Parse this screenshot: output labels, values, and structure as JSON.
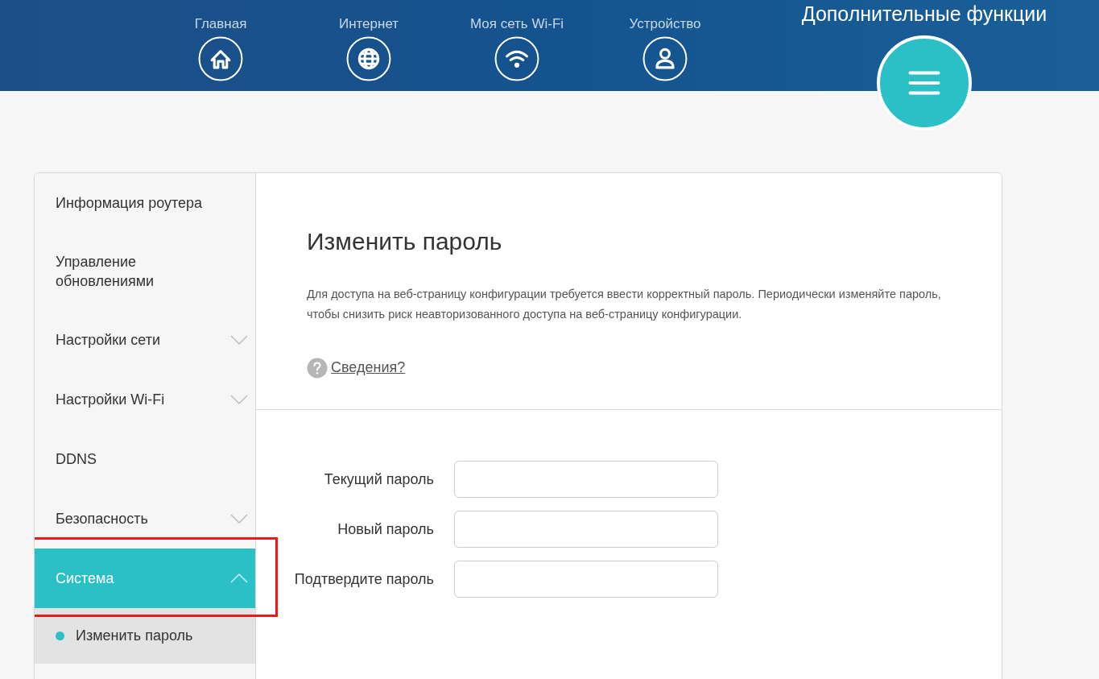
{
  "nav": [
    {
      "label": "Главная",
      "kind": "home",
      "selected": false
    },
    {
      "label": "Интернет",
      "kind": "globe",
      "selected": false
    },
    {
      "label": "Моя сеть Wi-Fi",
      "kind": "wifi",
      "selected": false
    },
    {
      "label": "Устройство",
      "kind": "user",
      "selected": false
    },
    {
      "label": "Дополнительные функции",
      "kind": "menu",
      "selected": true
    }
  ],
  "sidebar": {
    "items": [
      {
        "label": "Информация роутера",
        "expandable": false,
        "selected": false,
        "highlighted": false
      },
      {
        "label": "Управление обновлениями",
        "expandable": false,
        "selected": false,
        "highlighted": false
      },
      {
        "label": "Настройки сети",
        "expandable": true,
        "expanded": false,
        "selected": false,
        "highlighted": false
      },
      {
        "label": "Настройки Wi-Fi",
        "expandable": true,
        "expanded": false,
        "selected": false,
        "highlighted": false
      },
      {
        "label": "DDNS",
        "expandable": false,
        "selected": false,
        "highlighted": false
      },
      {
        "label": "Безопасность",
        "expandable": true,
        "expanded": false,
        "selected": false,
        "highlighted": false
      },
      {
        "label": "Система",
        "expandable": true,
        "expanded": true,
        "selected": true,
        "highlighted": true,
        "children": [
          {
            "label": "Изменить пароль",
            "selected": true
          }
        ]
      }
    ]
  },
  "content": {
    "title": "Изменить пароль",
    "description": "Для доступа на веб-страницу конфигурации требуется ввести корректный пароль. Периодически изменяйте пароль, чтобы снизить риск неавторизованного доступа на веб-страницу конфигурации.",
    "help_link": "Сведения?",
    "fields": [
      {
        "label": "Текущий пароль"
      },
      {
        "label": "Новый пароль"
      },
      {
        "label": "Подтвердите пароль"
      }
    ]
  }
}
